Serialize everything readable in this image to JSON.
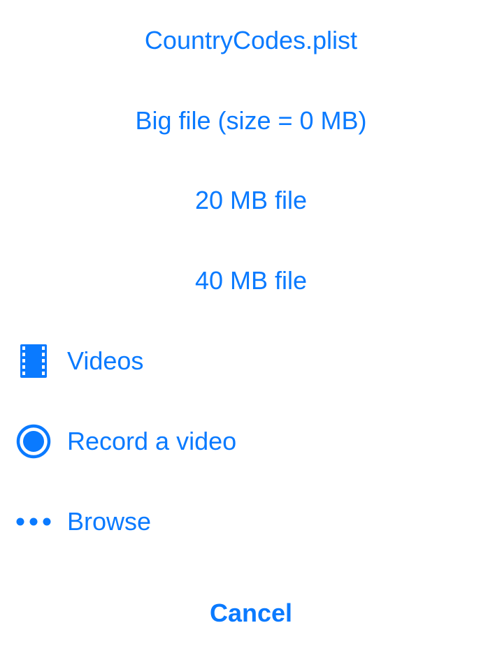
{
  "action_sheet": {
    "options": [
      {
        "label": "CountryCodes.plist"
      },
      {
        "label": "Big file (size = 0 MB)"
      },
      {
        "label": "20 MB file"
      },
      {
        "label": "40 MB file"
      }
    ],
    "icon_options": [
      {
        "label": "Videos",
        "icon": "film-strip-icon"
      },
      {
        "label": "Record a video",
        "icon": "record-circle-icon"
      },
      {
        "label": "Browse",
        "icon": "more-dots-icon"
      }
    ],
    "cancel_label": "Cancel"
  },
  "colors": {
    "accent": "#0a7aff",
    "background": "#ffffff"
  }
}
